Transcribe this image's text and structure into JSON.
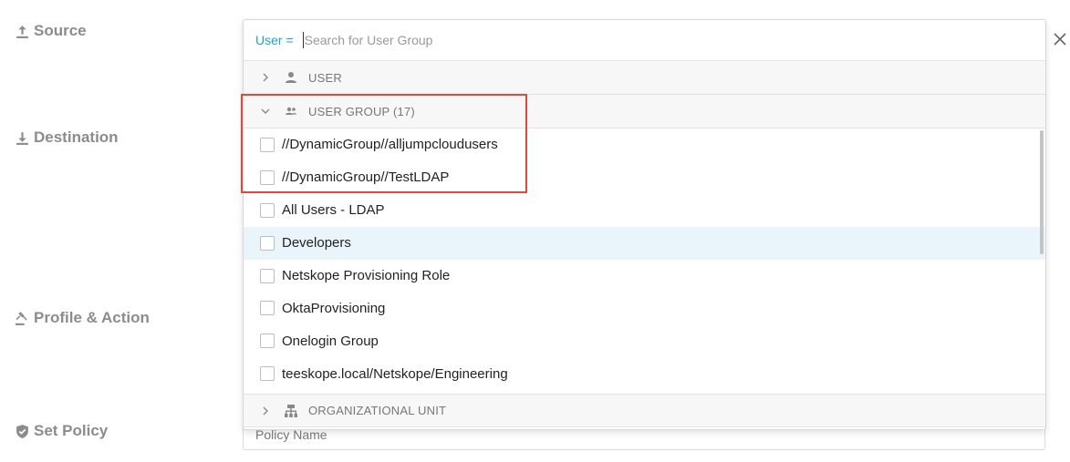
{
  "steps": {
    "source": "Source",
    "destination": "Destination",
    "profile": "Profile & Action",
    "policy": "Set Policy"
  },
  "search": {
    "prefix": "User =",
    "placeholder": "Search for User Group",
    "value": ""
  },
  "sections": {
    "user": "USER",
    "user_group": "USER GROUP (17)",
    "org_unit": "ORGANIZATIONAL UNIT"
  },
  "user_groups": [
    "//DynamicGroup//alljumpcloudusers",
    "//DynamicGroup//TestLDAP",
    "All Users - LDAP",
    "Developers",
    "Netskope Provisioning Role",
    "OktaProvisioning",
    "Onelogin Group",
    "teeskope.local/Netskope/Engineering"
  ],
  "hovered_item": "Developers",
  "policy_name_placeholder": "Policy Name",
  "colors": {
    "accent": "#1da1d8",
    "highlight_border": "#e4473b",
    "hover_row": "#e9f5fb"
  }
}
